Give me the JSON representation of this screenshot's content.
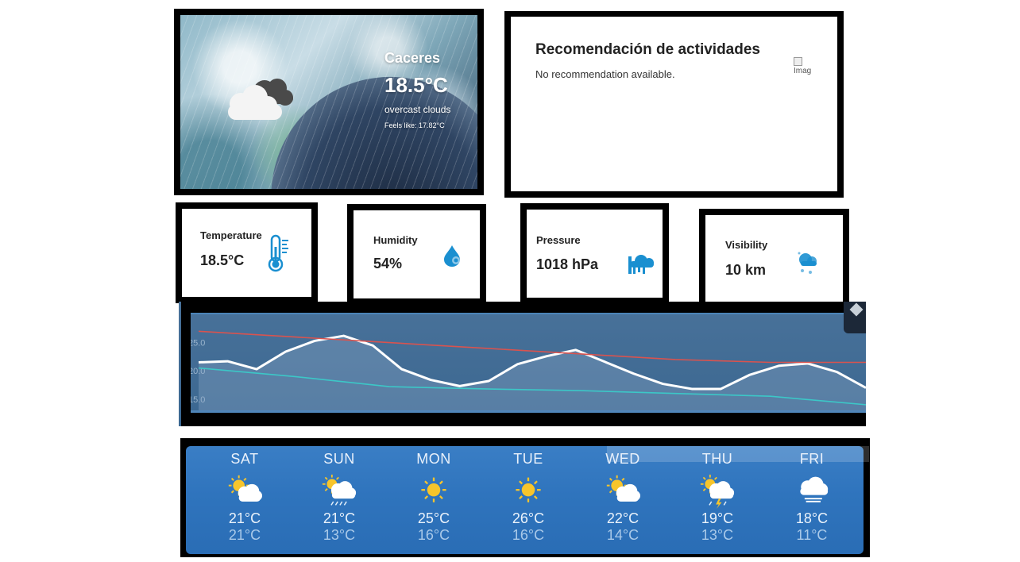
{
  "hero": {
    "city": "Caceres",
    "temperature": "18.5°C",
    "description": "overcast clouds",
    "feels_like": "Feels like: 17.82°C",
    "icon": "cloud-icon"
  },
  "recommendation": {
    "title": "Recomendación de actividades",
    "message": "No recommendation available.",
    "image_alt": "Imag"
  },
  "stats": [
    {
      "label": "Temperature",
      "value": "18.5°C",
      "icon": "thermometer-icon",
      "color": "#1a8fd0"
    },
    {
      "label": "Humidity",
      "value": "54%",
      "icon": "humidity-drop-icon",
      "color": "#1a8fd0"
    },
    {
      "label": "Pressure",
      "value": "1018 hPa",
      "icon": "pressure-icon",
      "color": "#1a8fd0"
    },
    {
      "label": "Visibility",
      "value": "10 km",
      "icon": "visibility-icon",
      "color": "#1a8fd0"
    }
  ],
  "chart_data": {
    "type": "line",
    "y_tick_labels": [
      "25.0",
      "20.0",
      "15.0"
    ],
    "ylim": [
      13,
      30
    ],
    "x": [
      0,
      1,
      2,
      3,
      4,
      5,
      6,
      7,
      8,
      9,
      10,
      11,
      12,
      13,
      14,
      15,
      16,
      17,
      18,
      19,
      20,
      21,
      22,
      23
    ],
    "series": [
      {
        "color": "#ffffff",
        "values": [
          21.5,
          21.7,
          20.3,
          23.4,
          25.3,
          26.2,
          24.5,
          20.3,
          18.4,
          17.3,
          18.2,
          21.2,
          22.6,
          23.7,
          21.6,
          19.5,
          17.7,
          16.8,
          16.8,
          19.3,
          20.9,
          21.3,
          19.8,
          17.0
        ]
      },
      {
        "color": "#d9534f",
        "values": [
          27.0,
          26.0,
          25.0,
          24.0,
          23.0,
          22.0,
          21.5,
          21.5
        ]
      },
      {
        "color": "#3cc7c7",
        "values": [
          20.5,
          19.0,
          17.2,
          16.8,
          16.5,
          16.0,
          15.5,
          14.0
        ]
      }
    ],
    "grid": false
  },
  "forecast": [
    {
      "day": "SAT",
      "icon": "sun-cloud-icon",
      "high": "21°C",
      "low": "21°C"
    },
    {
      "day": "SUN",
      "icon": "sun-cloud-rain-icon",
      "high": "21°C",
      "low": "13°C"
    },
    {
      "day": "MON",
      "icon": "sun-icon",
      "high": "25°C",
      "low": "16°C"
    },
    {
      "day": "TUE",
      "icon": "sun-icon",
      "high": "26°C",
      "low": "16°C"
    },
    {
      "day": "WED",
      "icon": "sun-cloud-icon",
      "high": "22°C",
      "low": "14°C"
    },
    {
      "day": "THU",
      "icon": "sun-cloud-storm-icon",
      "high": "19°C",
      "low": "13°C"
    },
    {
      "day": "FRI",
      "icon": "cloud-fog-icon",
      "high": "18°C",
      "low": "11°C"
    }
  ]
}
